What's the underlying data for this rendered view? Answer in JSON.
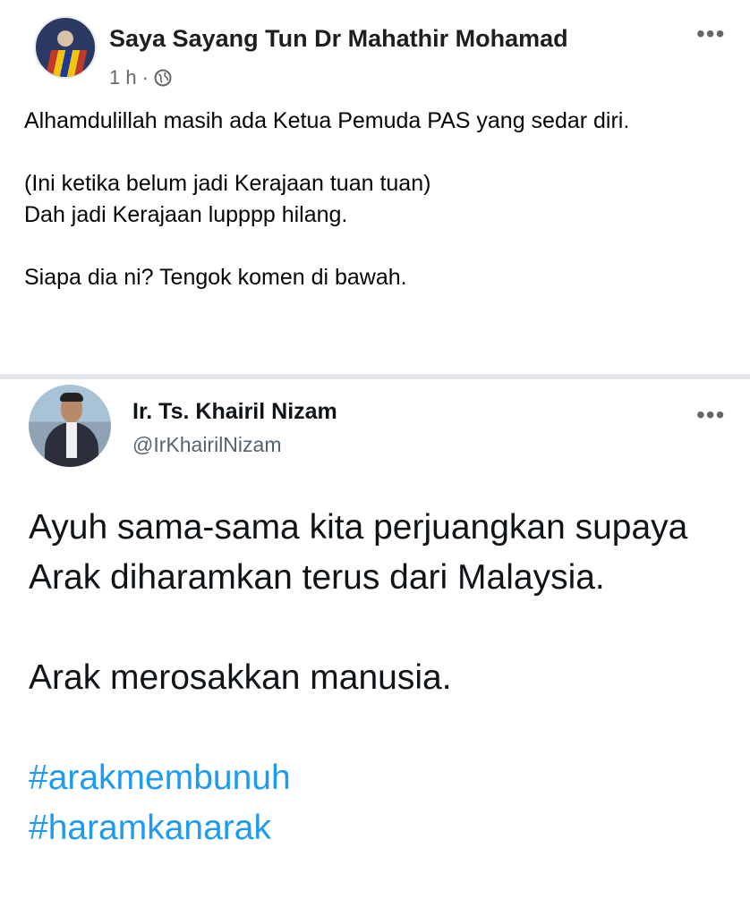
{
  "facebook_post": {
    "author": "Saya Sayang Tun Dr Mahathir Mohamad",
    "time": "1 h",
    "separator": "·",
    "visibility_icon": "globe-icon",
    "more_icon": "more-horizontal-icon",
    "more_label": "•••",
    "body": {
      "line1": "Alhamdulillah masih ada Ketua Pemuda PAS yang sedar diri.",
      "line2": "(Ini ketika belum jadi Kerajaan tuan tuan)",
      "line3": "Dah jadi Kerajaan lupppp hilang.",
      "line4": "Siapa dia ni? Tengok komen di bawah."
    }
  },
  "tweet": {
    "name": "Ir. Ts. Khairil Nizam",
    "handle": "@IrKhairilNizam",
    "more_icon": "more-horizontal-icon",
    "more_label": "•••",
    "body": {
      "paragraph1": "Ayuh sama-sama kita perjuangkan supaya Arak diharamkan terus dari Malaysia.",
      "paragraph2": "Arak merosakkan manusia.",
      "hashtag1": "#arakmembunuh",
      "hashtag2": "#haramkanarak"
    }
  },
  "colors": {
    "link_blue": "#1d9bf0",
    "meta_grey": "#65676b",
    "divider": "#e4e6ea"
  }
}
